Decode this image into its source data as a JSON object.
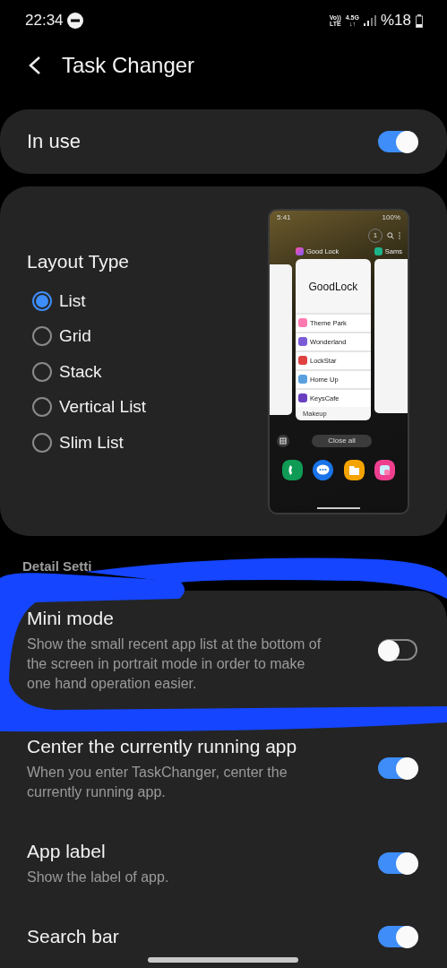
{
  "status_bar": {
    "time": "22:34",
    "badges": [
      {
        "top": "Vo))",
        "bottom": "LTE"
      },
      {
        "top": "4.5G",
        "bottom": "↓↑"
      }
    ],
    "battery": "%18"
  },
  "header": {
    "title": "Task Changer"
  },
  "in_use": {
    "label": "In use",
    "on": true
  },
  "layout": {
    "title": "Layout Type",
    "options": [
      {
        "label": "List",
        "selected": true
      },
      {
        "label": "Grid",
        "selected": false
      },
      {
        "label": "Stack",
        "selected": false
      },
      {
        "label": "Vertical List",
        "selected": false
      },
      {
        "label": "Slim List",
        "selected": false
      }
    ],
    "preview": {
      "time": "5:41",
      "battery": "100%",
      "task_count": "1",
      "focused_app": "Good Lock",
      "side_app": "Sams",
      "app_logo": "GoodLock",
      "list_items": [
        "Theme Park",
        "Wonderland",
        "LockStar",
        "Home Up",
        "KeysCafe"
      ],
      "footer_tab": "Makeup",
      "close_all": "Close all"
    }
  },
  "detail_label": "Detail Setti",
  "settings": [
    {
      "title": "Mini mode",
      "description": "Show the small recent app list at the bottom of the screen in portrait mode in order to make one hand operation easier.",
      "on": false
    },
    {
      "title": "Center the currently running app",
      "description": "When you enter TaskChanger, center the currently running app.",
      "on": true
    },
    {
      "title": "App label",
      "description": "Show the label of app.",
      "on": true
    },
    {
      "title": "Search bar",
      "on": true
    }
  ]
}
